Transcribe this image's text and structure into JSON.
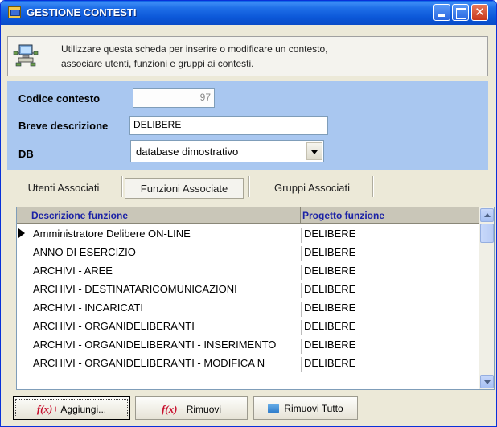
{
  "window": {
    "title": "GESTIONE CONTESTI"
  },
  "info": {
    "line1": "Utilizzare questa scheda per inserire o modificare un contesto,",
    "line2": "associare  utenti, funzioni e gruppi  ai contesti."
  },
  "form": {
    "code_label": "Codice contesto",
    "code_value": "97",
    "desc_label": "Breve descrizione",
    "desc_value": "DELIBERE",
    "db_label": "DB",
    "db_value": "database dimostrativo"
  },
  "tabs": [
    {
      "label": "Utenti Associati"
    },
    {
      "label": "Funzioni Associate"
    },
    {
      "label": "Gruppi Associati"
    }
  ],
  "grid": {
    "col_desc": "Descrizione funzione",
    "col_proj": "Progetto funzione",
    "rows": [
      {
        "desc": "Amministratore Delibere ON-LINE",
        "proj": "DELIBERE"
      },
      {
        "desc": "ANNO DI ESERCIZIO",
        "proj": "DELIBERE"
      },
      {
        "desc": "ARCHIVI - AREE",
        "proj": "DELIBERE"
      },
      {
        "desc": "ARCHIVI - DESTINATARICOMUNICAZIONI",
        "proj": "DELIBERE"
      },
      {
        "desc": "ARCHIVI - INCARICATI",
        "proj": "DELIBERE"
      },
      {
        "desc": "ARCHIVI - ORGANIDELIBERANTI",
        "proj": "DELIBERE"
      },
      {
        "desc": "ARCHIVI - ORGANIDELIBERANTI - INSERIMENTO",
        "proj": "DELIBERE"
      },
      {
        "desc": "ARCHIVI - ORGANIDELIBERANTI - MODIFICA N",
        "proj": "DELIBERE"
      }
    ]
  },
  "buttons": {
    "add_fx": "f(x)+",
    "add_label": "Aggiungi...",
    "remove_fx": "f(x)−",
    "remove_label": "Rimuovi",
    "removeall_label": "Rimuovi Tutto"
  }
}
